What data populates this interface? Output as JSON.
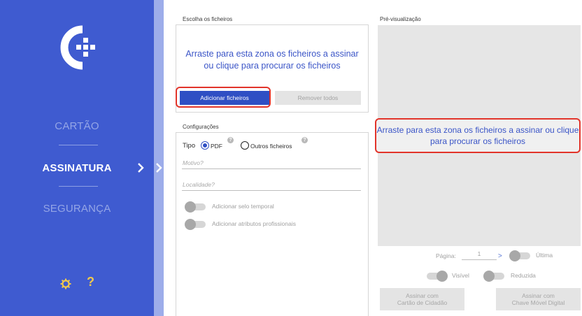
{
  "sidebar": {
    "nav": [
      {
        "label": "CARTÃO",
        "active": false
      },
      {
        "label": "ASSINATURA",
        "active": true
      },
      {
        "label": "SEGURANÇA",
        "active": false
      }
    ],
    "help_symbol": "?",
    "icons": [
      "logo-icon",
      "chevron-right-icon",
      "gear-icon",
      "help-icon"
    ]
  },
  "files": {
    "title": "Escolha os ficheiros",
    "drop_text": "Arraste para esta zona os ficheiros a assinar ou clique para procurar os ficheiros",
    "add_button": "Adicionar ficheiros",
    "remove_button": "Remover todos"
  },
  "config": {
    "title": "Configurações",
    "type_label": "Tipo",
    "options": [
      {
        "label": "PDF",
        "selected": true
      },
      {
        "label": "Outros ficheiros",
        "selected": false
      }
    ],
    "help_mark": "?",
    "reason_placeholder": "Motivo?",
    "location_placeholder": "Localidade?",
    "timestamp_toggle": "Adicionar selo temporal",
    "attributes_toggle": "Adicionar atributos profissionais"
  },
  "preview": {
    "title": "Pré-visualização",
    "drop_text": "Arraste para esta zona os ficheiros a assinar ou clique para procurar os ficheiros",
    "page_label": "Página:",
    "page_value": "1",
    "next_symbol": ">",
    "last_label": "Última",
    "visible_label": "Visível",
    "reduced_label": "Reduzida",
    "sign_cc_line1": "Assinar com",
    "sign_cc_line2": "Cartão de Cidadão",
    "sign_cmd_line1": "Assinar com",
    "sign_cmd_line2": "Chave Móvel Digital"
  },
  "colors": {
    "sidebar": "#3f5bd0",
    "accent": "#2f4fc4",
    "highlight": "#e2342a",
    "help": "#f2c94c"
  }
}
